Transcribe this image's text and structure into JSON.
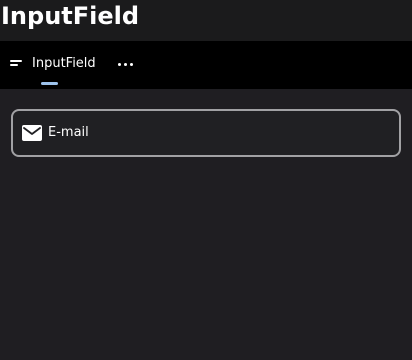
{
  "page": {
    "title": "InputField"
  },
  "tabs": [
    {
      "label": "InputField",
      "icon": "sort-lines-icon",
      "selected": true
    }
  ],
  "more_button": {
    "icon": "more-horizontal-icon"
  },
  "input": {
    "label": "E-mail",
    "value": "",
    "icon": "mail-icon"
  },
  "colors": {
    "background": "#1f1e22",
    "title_bar": "#1b1b1c",
    "tab_bar": "#000000",
    "tab_indicator": "#9ec3ec",
    "input_border": "#a1a1a4",
    "text": "#ffffff"
  }
}
